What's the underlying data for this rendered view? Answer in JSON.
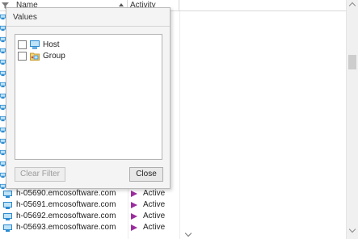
{
  "grid": {
    "columns": {
      "name": "Name",
      "activity": "Activity"
    },
    "rows": [
      {
        "name": "h-05690.emcosoftware.com",
        "status": "Active"
      },
      {
        "name": "h-05691.emcosoftware.com",
        "status": "Active"
      },
      {
        "name": "h-05692.emcosoftware.com",
        "status": "Active"
      },
      {
        "name": "h-05693.emcosoftware.com",
        "status": "Active"
      }
    ]
  },
  "filter_popup": {
    "title": "Values",
    "items": [
      {
        "label": "Host",
        "icon": "host-icon",
        "checked": false
      },
      {
        "label": "Group",
        "icon": "group-icon",
        "checked": false
      }
    ],
    "clear_label": "Clear Filter",
    "close_label": "Close"
  },
  "colors": {
    "active_marker": "#9b2d9f",
    "popup_bg": "#f4f4f4"
  }
}
